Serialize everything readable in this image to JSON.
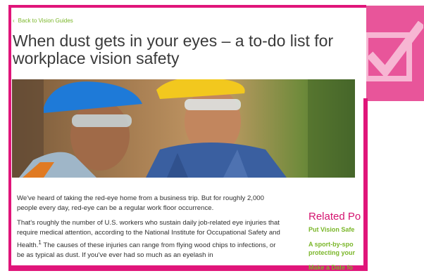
{
  "article": {
    "back_link": "Back to Vision Guides",
    "title_line1": "When dust gets in your eyes – a to-do list for",
    "title_line2": "workplace vision safety",
    "paragraph1": "We've heard of taking the red-eye home from a business trip. But for roughly 2,000 people every day, red-eye can be a regular work floor occurrence.",
    "paragraph2_before_sup": "That's roughly the number of U.S. workers who sustain daily job-related eye injuries that require medical attention, according to the National Institute for Occupational Safety and Health.",
    "paragraph2_sup": "1",
    "paragraph2_after_sup": " The causes of these injuries can range from flying wood chips to infections, or be as typical as dust. If you've ever had so much as an eyelash in"
  },
  "related": {
    "title": "Related Po",
    "links": [
      "Put Vision Safe",
      "A sport-by-spo",
      "protecting your",
      "Make a Date fo"
    ]
  },
  "colors": {
    "frame": "#e0157a",
    "accent_green": "#7ab628",
    "related_title": "#d4136f",
    "check_tile": "#e8559a"
  }
}
